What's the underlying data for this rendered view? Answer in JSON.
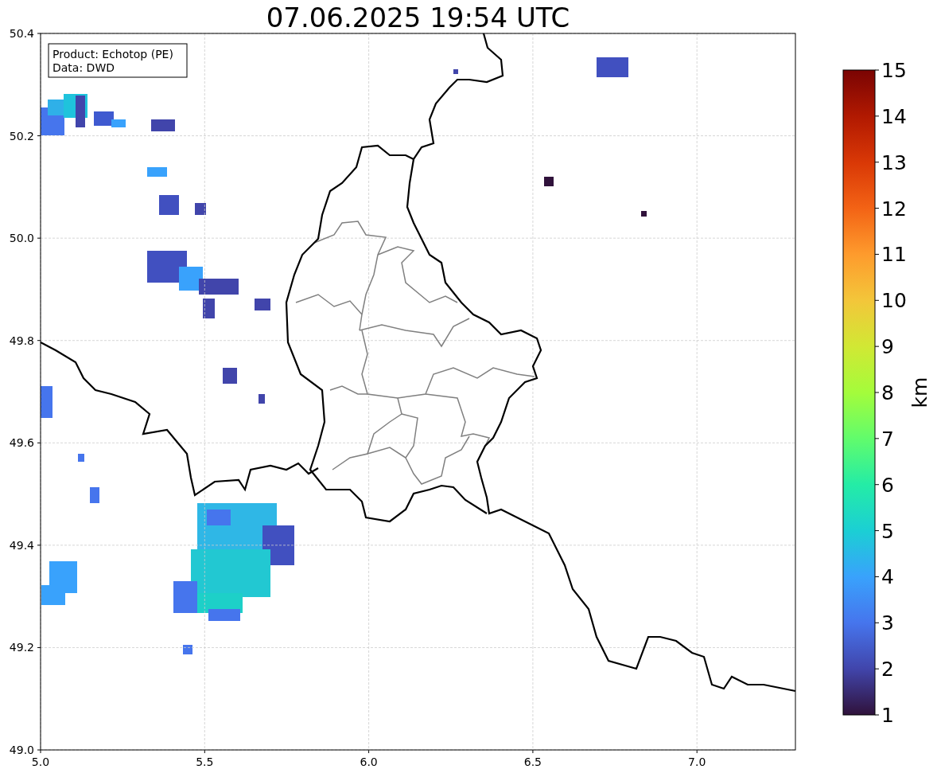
{
  "title": "07.06.2025 19:54 UTC",
  "info_box": [
    "Product: Echotop (PE)",
    "Data: DWD"
  ],
  "map": {
    "x_ticks": [
      "5.0",
      "5.5",
      "6.0",
      "6.5",
      "7.0"
    ],
    "y_ticks": [
      "50.4",
      "50.2",
      "50.0",
      "49.8",
      "49.6",
      "49.4",
      "49.2",
      "49.0"
    ]
  },
  "colorbar": {
    "label": "km",
    "ticks": [
      "15",
      "14",
      "13",
      "12",
      "11",
      "10",
      "9",
      "8",
      "7",
      "6",
      "5",
      "4",
      "3",
      "2",
      "1"
    ]
  }
}
